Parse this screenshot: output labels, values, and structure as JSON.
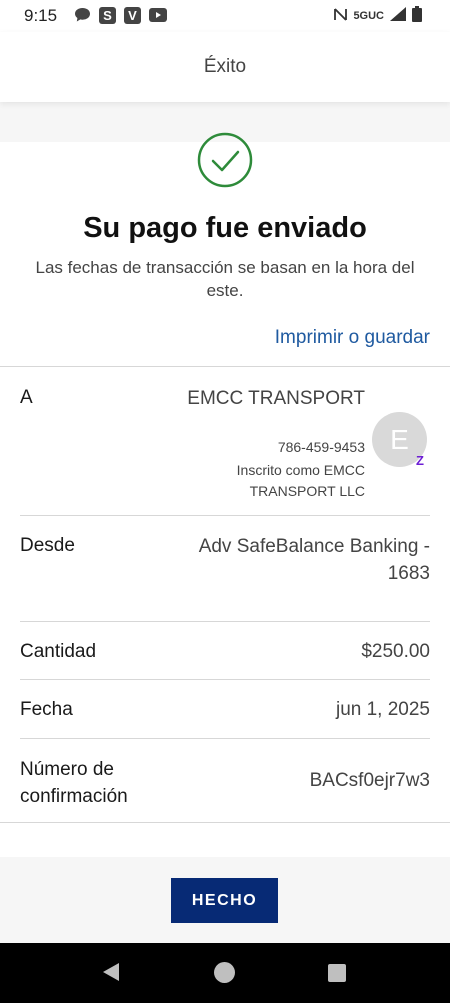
{
  "status_bar": {
    "time": "9:15",
    "left_icons": [
      "chat-bubble-icon",
      "s-app-icon",
      "v-app-icon",
      "youtube-icon"
    ],
    "s_icon_letter": "S",
    "v_icon_letter": "V",
    "network_label": "5GUC",
    "right_icons": [
      "nfc-icon",
      "signal-icon",
      "battery-icon"
    ]
  },
  "header": {
    "title": "Éxito"
  },
  "success": {
    "headline": "Su pago fue enviado",
    "note": "Las fechas de transacción se basan en la hora del este.",
    "print_link": "Imprimir o guardar",
    "accent_color": "#2e8b3a"
  },
  "details": {
    "to": {
      "label": "A",
      "name": "EMCC TRANSPORT",
      "phone": "786-459-9453",
      "enrolled": "Inscrito como EMCC TRANSPORT LLC",
      "avatar_letter": "E",
      "badge_letter": "Z"
    },
    "from": {
      "label": "Desde",
      "value": "Adv SafeBalance Banking - 1683"
    },
    "amount": {
      "label": "Cantidad",
      "value": "$250.00"
    },
    "date": {
      "label": "Fecha",
      "value": "jun 1, 2025"
    },
    "confirmation": {
      "label": "Número de confirmación",
      "value": "BACsf0ejr7w3"
    }
  },
  "footer": {
    "done_label": "HECHO",
    "button_color": "#072a75"
  },
  "nav_bar": {
    "icons": [
      "back-icon",
      "home-icon",
      "recents-icon"
    ]
  }
}
